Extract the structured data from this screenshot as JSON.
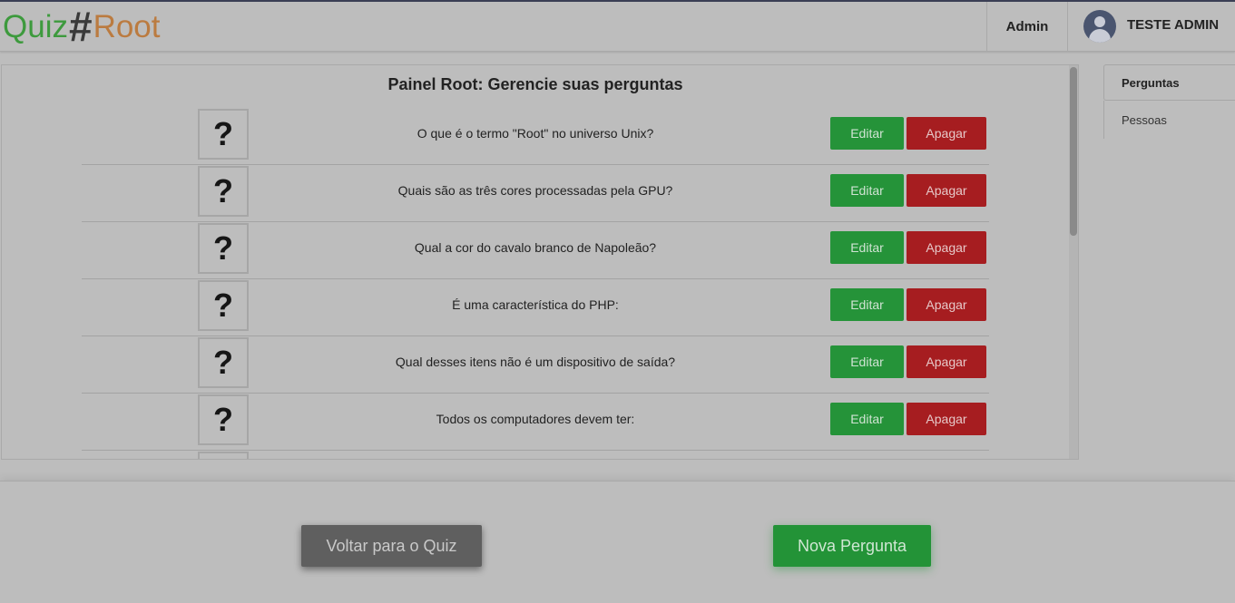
{
  "header": {
    "logo_quiz": "Quiz",
    "logo_hash": "#",
    "logo_root": "Root",
    "admin_link": "Admin",
    "user_name": "TESTE ADMIN"
  },
  "panel": {
    "title": "Painel Root: Gerencie suas perguntas",
    "question_icon": "?",
    "edit_label": "Editar",
    "delete_label": "Apagar",
    "questions": [
      "O que é o termo \"Root\" no universo Unix?",
      "Quais são as três cores processadas pela GPU?",
      "Qual a cor do cavalo branco de Napoleão?",
      "É uma característica do PHP:",
      "Qual desses itens não é um dispositivo de saída?",
      "Todos os computadores devem ter:"
    ]
  },
  "sidebar": {
    "tabs": [
      "Perguntas",
      "Pessoas"
    ]
  },
  "footer": {
    "back_label": "Voltar para o Quiz",
    "new_label": "Nova Pergunta"
  },
  "colors": {
    "edit": "#259339",
    "delete": "#a61d20",
    "back": "#5f5f5f",
    "new": "#239337"
  }
}
